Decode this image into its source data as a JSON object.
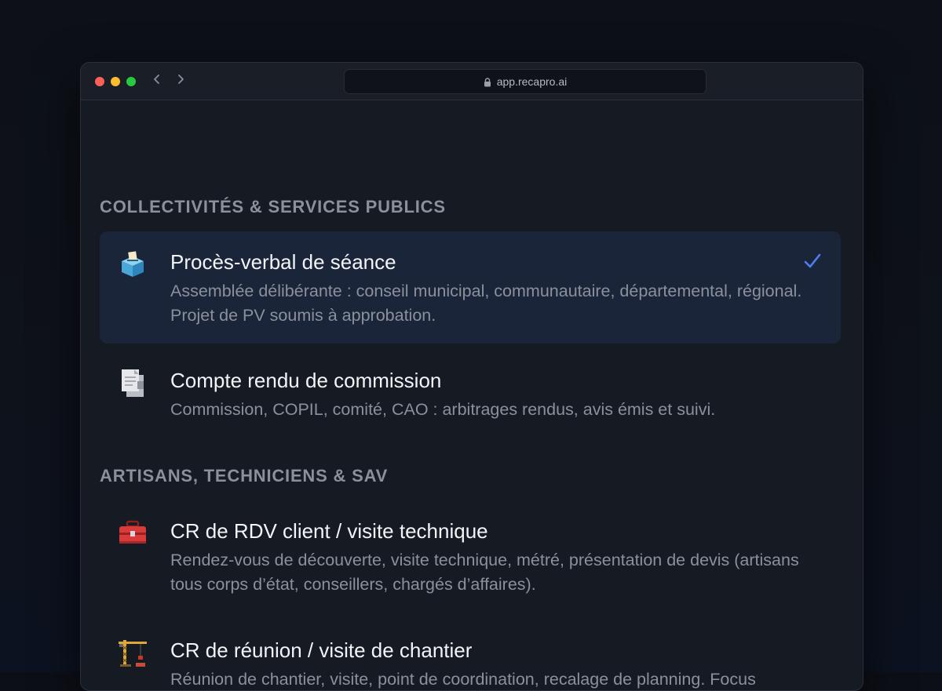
{
  "browser": {
    "url": "app.recapro.ai"
  },
  "sections": [
    {
      "title": "COLLECTIVITÉS & SERVICES PUBLICS",
      "items": [
        {
          "title": "Procès-verbal de séance",
          "description": "Assemblée délibérante : conseil municipal, communautaire, départemental, régional. Projet de PV soumis à approbation.",
          "icon": "ballot-box-icon",
          "selected": true
        },
        {
          "title": "Compte rendu de commission",
          "description": "Commission, COPIL, comité, CAO : arbitrages rendus, avis émis et suivi.",
          "icon": "documents-icon",
          "selected": false
        }
      ]
    },
    {
      "title": "ARTISANS, TECHNICIENS & SAV",
      "items": [
        {
          "title": "CR de RDV client / visite technique",
          "description": "Rendez-vous de découverte, visite technique, métré, présentation de devis (artisans tous corps d’état, conseillers, chargés d’affaires).",
          "icon": "toolbox-icon",
          "selected": false
        },
        {
          "title": "CR de réunion / visite de chantier",
          "description": "Réunion de chantier, visite, point de coordination, recalage de planning. Focus avancement par lot, jalons et échéances.",
          "icon": "construction-crane-icon",
          "selected": false
        }
      ]
    }
  ],
  "colors": {
    "accent_check": "#4f7df5",
    "selected_bg": "#1b2539"
  }
}
